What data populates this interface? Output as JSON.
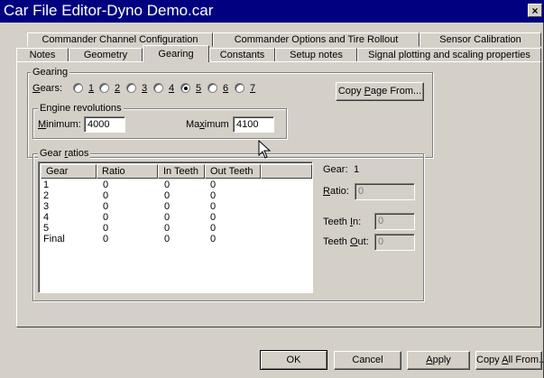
{
  "window": {
    "title": "Car File Editor-Dyno Demo.car",
    "close_symbol": "×"
  },
  "tabs_row1": [
    "Commander Channel Configuration",
    "Commander Options and Tire Rollout",
    "Sensor Calibration"
  ],
  "tabs_row2": [
    "Notes",
    "Geometry",
    "Gearing",
    "Constants",
    "Setup notes",
    "Signal plotting and scaling properties"
  ],
  "active_tab": "Gearing",
  "gearing": {
    "group_label": "Gearing",
    "gears_label_u": "G",
    "gears_label_rest": "ears:",
    "radios": [
      "1",
      "2",
      "3",
      "4",
      "5",
      "6",
      "7"
    ],
    "selected_gear": "5",
    "copy_page_button_pre": "Copy ",
    "copy_page_button_u": "P",
    "copy_page_button_post": "age From..."
  },
  "engine": {
    "group_label": "Engine revolutions",
    "min_label_u": "M",
    "min_label_rest": "inimum:",
    "min_value": "4000",
    "max_label_pre": "Ma",
    "max_label_u": "x",
    "max_label_post": "imum",
    "max_value": "4100"
  },
  "gear_ratios": {
    "group_label_pre": "Gear ",
    "group_label_u": "r",
    "group_label_post": "atios",
    "columns": [
      "Gear",
      "Ratio",
      "In Teeth",
      "Out Teeth"
    ],
    "rows": [
      [
        "1",
        "0",
        "0",
        "0"
      ],
      [
        "2",
        "0",
        "0",
        "0"
      ],
      [
        "3",
        "0",
        "0",
        "0"
      ],
      [
        "4",
        "0",
        "0",
        "0"
      ],
      [
        "5",
        "0",
        "0",
        "0"
      ],
      [
        "Final",
        "0",
        "0",
        "0"
      ]
    ]
  },
  "details": {
    "gear_label": "Gear:",
    "gear_value": "1",
    "ratio_label_u": "R",
    "ratio_label_rest": "atio:",
    "ratio_value": "0",
    "teeth_in_label_pre": "Teeth ",
    "teeth_in_label_u": "I",
    "teeth_in_label_post": "n:",
    "teeth_in_value": "0",
    "teeth_out_label_pre": "Teeth ",
    "teeth_out_label_u": "O",
    "teeth_out_label_post": "ut:",
    "teeth_out_value": "0"
  },
  "buttons": {
    "ok": "OK",
    "cancel": "Cancel",
    "apply_u": "A",
    "apply_rest": "pply",
    "copy_all_pre": "Copy ",
    "copy_all_u": "A",
    "copy_all_post": "ll From..."
  }
}
